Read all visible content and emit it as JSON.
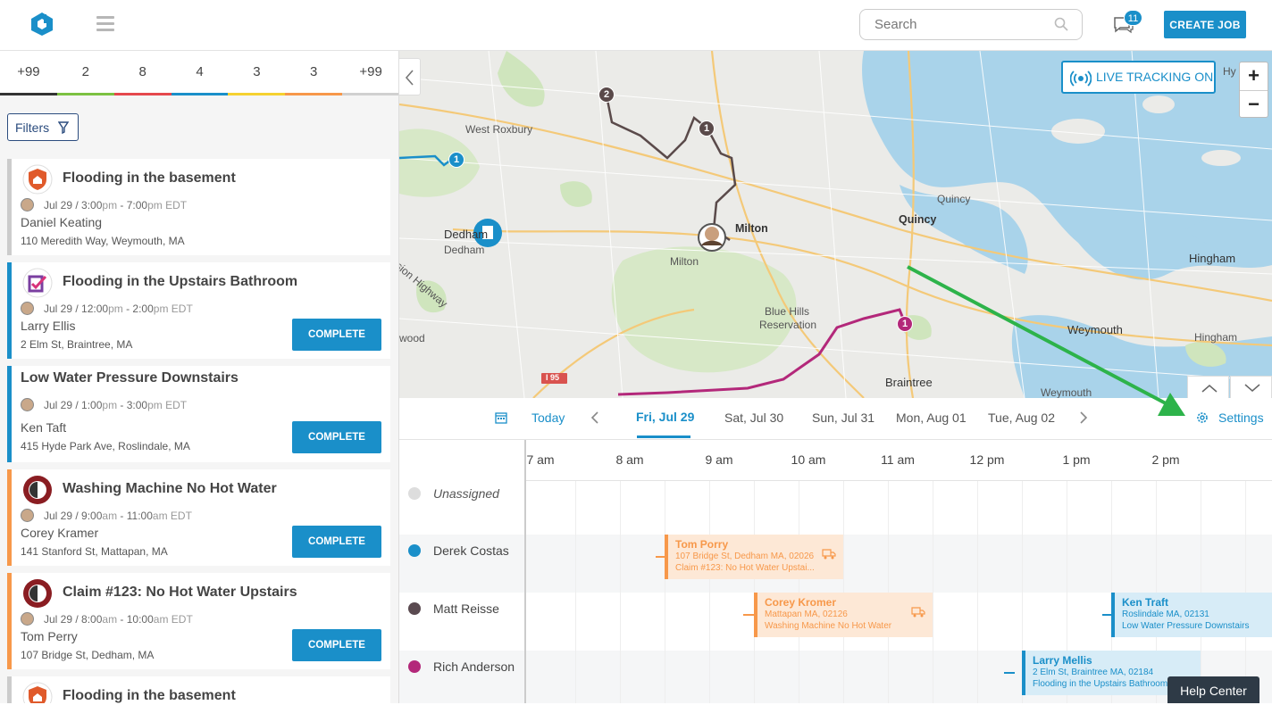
{
  "header": {
    "search_placeholder": "Search",
    "chat_count": "11",
    "create_job_label": "CREATE JOB"
  },
  "status_counts": [
    {
      "value": "+99",
      "color": "#333333"
    },
    {
      "value": "2",
      "color": "#7cc142"
    },
    {
      "value": "8",
      "color": "#e5484d"
    },
    {
      "value": "4",
      "color": "#1a8fc9"
    },
    {
      "value": "3",
      "color": "#f5d130"
    },
    {
      "value": "3",
      "color": "#f7984a"
    },
    {
      "value": "+99",
      "color": "#d0d0d0"
    }
  ],
  "filters_label": "Filters",
  "jobs": [
    {
      "title": "Flooding in the basement",
      "date": "Jul 29",
      "start": "3:00",
      "start_ampm": "pm",
      "end": "7:00",
      "end_ampm": "pm",
      "tz": "EDT",
      "customer": "Daniel Keating",
      "address": "110 Meredith Way, Weymouth, MA",
      "complete_label": "",
      "border": "#cccccc"
    },
    {
      "title": "Flooding in the Upstairs Bathroom",
      "date": "Jul 29",
      "start": "12:00",
      "start_ampm": "pm",
      "end": "2:00",
      "end_ampm": "pm",
      "tz": "EDT",
      "customer": "Larry Ellis",
      "address": "2 Elm St, Braintree, MA",
      "complete_label": "COMPLETE",
      "border": "#1a8fc9"
    },
    {
      "title": "Low Water Pressure Downstairs",
      "date": "Jul 29",
      "start": "1:00",
      "start_ampm": "pm",
      "end": "3:00",
      "end_ampm": "pm",
      "tz": "EDT",
      "customer": "Ken Taft",
      "address": "415 Hyde Park Ave, Roslindale, MA",
      "complete_label": "COMPLETE",
      "border": "#1a8fc9"
    },
    {
      "title": "Washing Machine No Hot Water",
      "date": "Jul 29",
      "start": "9:00",
      "start_ampm": "am",
      "end": "11:00",
      "end_ampm": "am",
      "tz": "EDT",
      "customer": "Corey Kramer",
      "address": "141 Stanford St, Mattapan, MA",
      "complete_label": "COMPLETE",
      "border": "#f7984a"
    },
    {
      "title": "Claim #123: No Hot Water Upstairs",
      "date": "Jul 29",
      "start": "8:00",
      "start_ampm": "am",
      "end": "10:00",
      "end_ampm": "am",
      "tz": "EDT",
      "customer": "Tom Perry",
      "address": "107 Bridge St, Dedham, MA",
      "complete_label": "COMPLETE",
      "border": "#f7984a"
    },
    {
      "title": "Flooding in the basement",
      "border": "#cccccc"
    }
  ],
  "map": {
    "live_tracking_label": "LIVE TRACKING ON",
    "zoom_in": "+",
    "zoom_out": "−",
    "labels": [
      "West Roxbury",
      "Dedham",
      "Dedham",
      "Milton",
      "Milton",
      "Quincy",
      "Quincy",
      "Hingham",
      "Hingham",
      "Blue Hills",
      "Reservation",
      "Weymouth",
      "Weymouth",
      "Braintree",
      "I 95",
      "Hy",
      "wood",
      "ision Highway"
    ],
    "pins": [
      "2",
      "1",
      "1",
      "1"
    ]
  },
  "day_nav": {
    "today_label": "Today",
    "days": [
      "Fri, Jul 29",
      "Sat, Jul 30",
      "Sun, Jul 31",
      "Mon, Aug 01",
      "Tue, Aug 02"
    ],
    "settings_label": "Settings"
  },
  "schedule": {
    "hours": [
      "7 am",
      "8 am",
      "9 am",
      "10 am",
      "11 am",
      "12 pm",
      "1 pm",
      "2 pm"
    ],
    "techs": [
      {
        "name": "Unassigned",
        "color": "#dddddd"
      },
      {
        "name": "Derek Costas",
        "color": "#1a8fc9"
      },
      {
        "name": "Matt Reisse",
        "color": "#5a4a50"
      },
      {
        "name": "Rich Anderson",
        "color": "#b3287a"
      }
    ],
    "jobs": [
      {
        "name": "Tom Porry",
        "line1": "107 Bridge St, Dedham MA, 02026",
        "line2": "Claim #123: No Hot Water Upstai...",
        "color": "#f7984a",
        "bg": "#fde8d6"
      },
      {
        "name": "Corey Kromer",
        "line1": "Mattapan MA, 02126",
        "line2": "Washing Machine No Hot Water",
        "color": "#f7984a",
        "bg": "#fde8d6"
      },
      {
        "name": "Ken Traft",
        "line1": "Roslindale MA, 02131",
        "line2": "Low Water Pressure Downstairs",
        "color": "#1a8fc9",
        "bg": "#d7ecf7"
      },
      {
        "name": "Larry Mellis",
        "line1": "2 Elm St, Braintree MA, 02184",
        "line2": "Flooding in the Upstairs Bathroom",
        "color": "#1a8fc9",
        "bg": "#d7ecf7"
      }
    ]
  },
  "help_center_label": "Help Center"
}
